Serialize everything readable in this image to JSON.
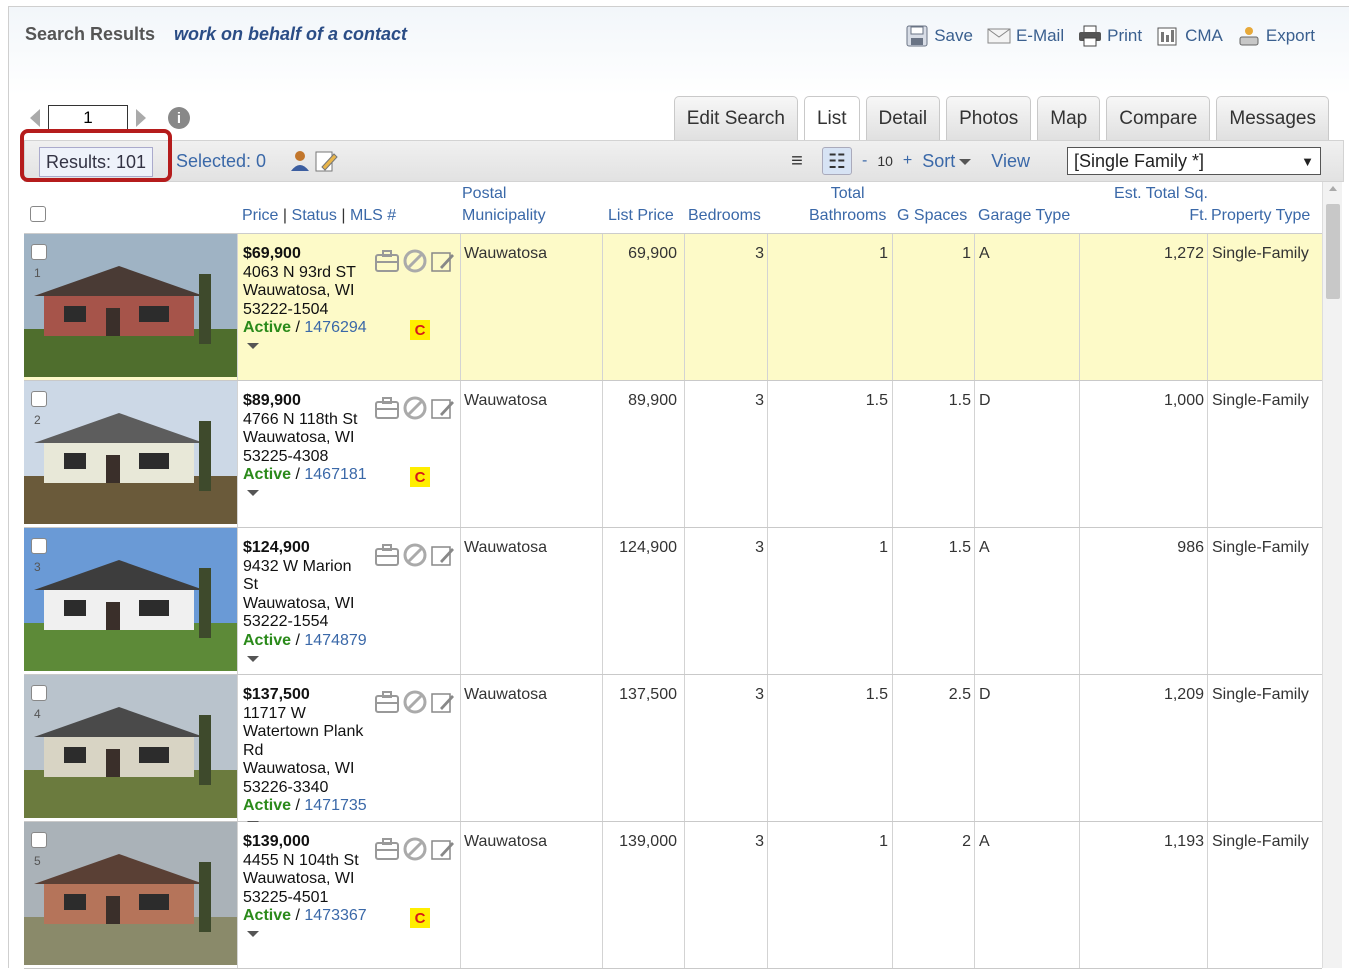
{
  "header": {
    "title": "Search Results",
    "subtitle": "work on behalf of a contact",
    "actions": [
      {
        "label": "Save",
        "icon": "floppy-icon"
      },
      {
        "label": "E-Mail",
        "icon": "mail-icon"
      },
      {
        "label": "Print",
        "icon": "printer-icon"
      },
      {
        "label": "CMA",
        "icon": "cma-icon"
      },
      {
        "label": "Export",
        "icon": "export-icon"
      }
    ]
  },
  "pager": {
    "page": "1"
  },
  "tabs": [
    "Edit Search",
    "List",
    "Detail",
    "Photos",
    "Map",
    "Compare",
    "Messages"
  ],
  "active_tab": "List",
  "toolbar": {
    "results": "Results: 101",
    "selected": "Selected: 0",
    "minus": "-",
    "per_page": "10",
    "plus": "+",
    "sort": "Sort",
    "view": "View",
    "view_select": "[Single Family *]"
  },
  "columns": {
    "price_status": "Price",
    "sep1": "|",
    "status": "Status",
    "sep2": "|",
    "mls": "MLS #",
    "postal_1": "Postal",
    "postal_2": "Municipality",
    "list_price": "List Price",
    "bedrooms": "Bedrooms",
    "baths_1": "Total",
    "baths_2": "Bathrooms",
    "gspaces": "G Spaces",
    "garage": "Garage Type",
    "sqft_1": "Est. Total Sq.",
    "sqft_2": "Ft.",
    "ptype": "Property Type"
  },
  "rows": [
    {
      "num": "1",
      "price": "$69,900",
      "addr": [
        "4063 N 93rd ST",
        "Wauwatosa, WI",
        "53222-1504"
      ],
      "status": "Active",
      "mls": "1476294",
      "badge": "C",
      "municipality": "Wauwatosa",
      "list_price": "69,900",
      "bedrooms": "3",
      "bathrooms": "1",
      "gspaces": "1",
      "garage": "A",
      "sqft": "1,272",
      "ptype": "Single-Family"
    },
    {
      "num": "2",
      "price": "$89,900",
      "addr": [
        "4766 N 118th St",
        "Wauwatosa, WI",
        "53225-4308"
      ],
      "status": "Active",
      "mls": "1467181",
      "badge": "C",
      "municipality": "Wauwatosa",
      "list_price": "89,900",
      "bedrooms": "3",
      "bathrooms": "1.5",
      "gspaces": "1.5",
      "garage": "D",
      "sqft": "1,000",
      "ptype": "Single-Family"
    },
    {
      "num": "3",
      "price": "$124,900",
      "addr": [
        "9432 W Marion",
        "St",
        "Wauwatosa, WI 53222-1554"
      ],
      "status": "Active",
      "mls": "1474879",
      "badge": "",
      "municipality": "Wauwatosa",
      "list_price": "124,900",
      "bedrooms": "3",
      "bathrooms": "1",
      "gspaces": "1.5",
      "garage": "A",
      "sqft": "986",
      "ptype": "Single-Family"
    },
    {
      "num": "4",
      "price": "$137,500",
      "addr": [
        "11717 W",
        "Watertown Plank",
        "Rd",
        "Wauwatosa, WI 53226-3340"
      ],
      "status": "Active",
      "mls": "1471735",
      "badge": "",
      "municipality": "Wauwatosa",
      "list_price": "137,500",
      "bedrooms": "3",
      "bathrooms": "1.5",
      "gspaces": "2.5",
      "garage": "D",
      "sqft": "1,209",
      "ptype": "Single-Family"
    },
    {
      "num": "5",
      "price": "$139,000",
      "addr": [
        "4455 N 104th St",
        "Wauwatosa, WI",
        "53225-4501"
      ],
      "status": "Active",
      "mls": "1473367",
      "badge": "C",
      "municipality": "Wauwatosa",
      "list_price": "139,000",
      "bedrooms": "3",
      "bathrooms": "1",
      "gspaces": "2",
      "garage": "A",
      "sqft": "1,193",
      "ptype": "Single-Family"
    }
  ],
  "colors": {
    "accent": "#3a68a8",
    "status_active": "#2a8a1a",
    "highlight_row": "#fdfac8",
    "badge_bg": "#ffee00",
    "badge_text": "#d61a1a",
    "focus_frame": "#b51c1c"
  }
}
